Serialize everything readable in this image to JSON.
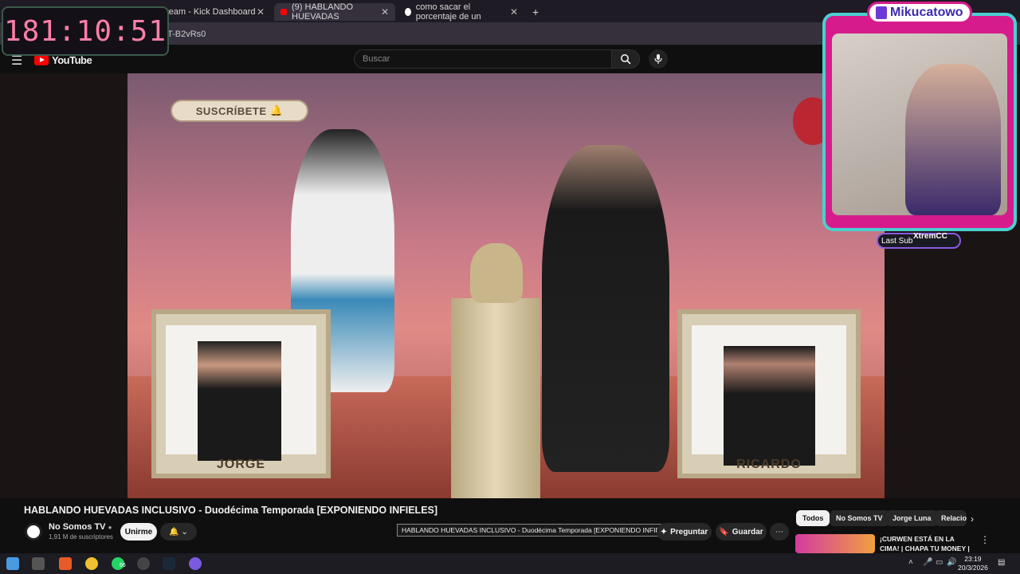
{
  "browser": {
    "tabs": [
      {
        "label": "ream - Kick Dashboard",
        "close": "✕"
      },
      {
        "label": "(9) HABLANDO HUEVADAS",
        "close": "✕"
      },
      {
        "label": "como sacar el porcentaje de un",
        "close": "✕"
      }
    ],
    "new_tab": "+",
    "address": "T-B2vRs0"
  },
  "overlay": {
    "timer": "181:10:51",
    "streamer_name": "Mikucatowo",
    "last_sub_label": "Last Sub",
    "last_sub_name": "XtremCC"
  },
  "youtube": {
    "logo": "YouTube",
    "search_placeholder": "Buscar",
    "video": {
      "subscribe_banner": "SUSCRÍBETE",
      "interpreter_left": "JORGE",
      "interpreter_right": "RICARDO"
    },
    "title": "HABLANDO HUEVADAS INCLUSIVO - Duodécima Temporada [EXPONIENDO INFIELES]",
    "tooltip": "HABLANDO HUEVADAS INCLUSIVO - Duodécima Temporada [EXPONIENDO INFIELES]",
    "channel": {
      "name": "No Somos TV",
      "subs": "1,91 M de suscriptores"
    },
    "buttons": {
      "join": "Unirme",
      "bell": "🔔 ⌄",
      "ask": "Preguntar",
      "save": "Guardar",
      "more": "⋯"
    },
    "chips": [
      "Todos",
      "No Somos TV",
      "Jorge Luna",
      "Relacio"
    ],
    "recommendation": {
      "title": "¡CURWEN ESTÁ EN LA CIMA! | CHAPA TU MONEY | CTM"
    }
  },
  "taskbar": {
    "whatsapp_badge": "66",
    "time": "23:19",
    "date": "20/3/2026"
  },
  "colors": {
    "yt_red": "#ff0000",
    "overlay_pink": "#d61c8c",
    "overlay_cyan": "#4ad0d0",
    "timer_pink": "#ff7fa8"
  }
}
